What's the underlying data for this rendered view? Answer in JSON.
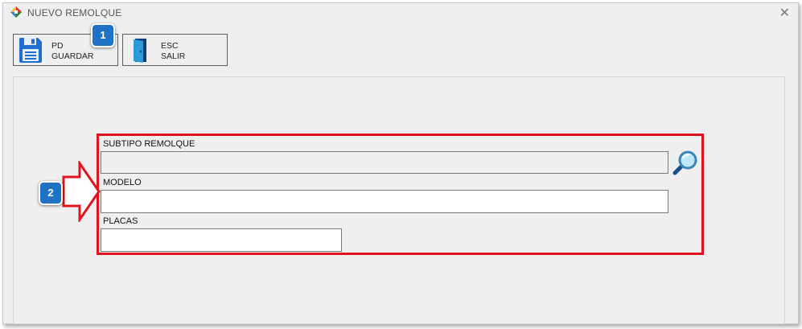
{
  "window": {
    "title": "NUEVO REMOLQUE",
    "close_glyph": "✕"
  },
  "toolbar": {
    "save": {
      "shortcut": "PD",
      "label": "GUARDAR",
      "icon": "floppy-disk-icon"
    },
    "exit": {
      "shortcut": "ESC",
      "label": "SALIR",
      "icon": "exit-door-icon"
    }
  },
  "form": {
    "subtipo": {
      "label": "SUBTIPO REMOLQUE",
      "value": "",
      "search_icon": "magnifier-icon"
    },
    "modelo": {
      "label": "MODELO",
      "value": ""
    },
    "placas": {
      "label": "PLACAS",
      "value": ""
    }
  },
  "annotations": {
    "badge1": "1",
    "badge2": "2",
    "highlight_color": "#e0141e",
    "badge_color": "#1f73c7"
  }
}
